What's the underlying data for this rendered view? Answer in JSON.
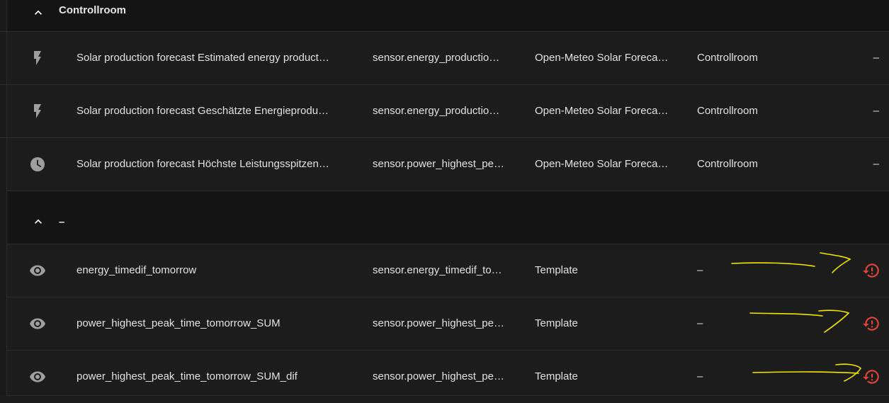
{
  "groups": [
    {
      "title": "Controllroom",
      "rows": [
        {
          "icon": "flash-icon",
          "name": "Solar production forecast Estimated energy product…",
          "entity_id": "sensor.energy_productio…",
          "integration": "Open-Meteo Solar Foreca…",
          "area": "Controllroom",
          "status": "–"
        },
        {
          "icon": "flash-icon",
          "name": "Solar production forecast Geschätzte Energieprodu…",
          "entity_id": "sensor.energy_productio…",
          "integration": "Open-Meteo Solar Foreca…",
          "area": "Controllroom",
          "status": "–"
        },
        {
          "icon": "clock-icon",
          "name": "Solar production forecast Höchste Leistungsspitzen…",
          "entity_id": "sensor.power_highest_pe…",
          "integration": "Open-Meteo Solar Foreca…",
          "area": "Controllroom",
          "status": "–"
        }
      ]
    },
    {
      "title": "–",
      "rows": [
        {
          "icon": "eye-icon",
          "name": "energy_timedif_tomorrow",
          "entity_id": "sensor.energy_timedif_to…",
          "integration": "Template",
          "area": "–",
          "status": "restore-alert-icon"
        },
        {
          "icon": "eye-icon",
          "name": "power_highest_peak_time_tomorrow_SUM",
          "entity_id": "sensor.power_highest_pe…",
          "integration": "Template",
          "area": "–",
          "status": "restore-alert-icon"
        },
        {
          "icon": "eye-icon",
          "name": "power_highest_peak_time_tomorrow_SUM_dif",
          "entity_id": "sensor.power_highest_pe…",
          "integration": "Template",
          "area": "–",
          "status": "restore-alert-icon"
        }
      ]
    }
  ],
  "colors": {
    "accent_alert": "#db4437",
    "annotation": "#f2e600"
  }
}
